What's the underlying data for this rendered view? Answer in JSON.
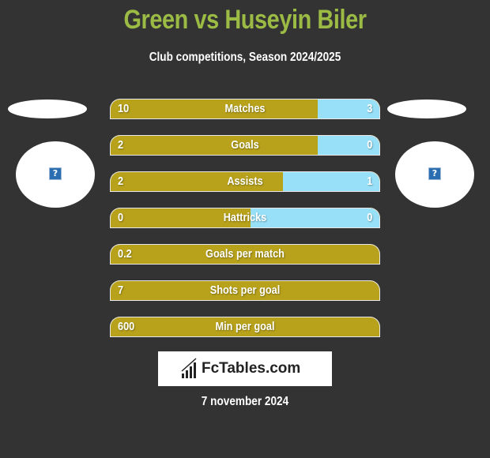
{
  "header": {
    "title": "Green vs Huseyin Biler",
    "subtitle": "Club competitions, Season 2024/2025"
  },
  "players": {
    "left": {
      "name": "Green",
      "avatar_icon": "question-image-icon"
    },
    "right": {
      "name": "Huseyin Biler",
      "avatar_icon": "question-image-icon"
    }
  },
  "colors": {
    "background": "#333333",
    "title": "#9bbb45",
    "left_bar": "#b8a21b",
    "right_bar": "#98e0f8"
  },
  "stats": [
    {
      "label": "Matches",
      "left": "10",
      "right": "3",
      "left_share": 0.77
    },
    {
      "label": "Goals",
      "left": "2",
      "right": "0",
      "left_share": 0.77
    },
    {
      "label": "Assists",
      "left": "2",
      "right": "1",
      "left_share": 0.64
    },
    {
      "label": "Hattricks",
      "left": "0",
      "right": "0",
      "left_share": 0.52
    },
    {
      "label": "Goals per match",
      "left": "0.2",
      "right": "",
      "left_share": 1.0
    },
    {
      "label": "Shots per goal",
      "left": "7",
      "right": "",
      "left_share": 1.0
    },
    {
      "label": "Min per goal",
      "left": "600",
      "right": "",
      "left_share": 1.0
    }
  ],
  "footer": {
    "logo_text": "FcTables.com",
    "date": "7 november 2024"
  }
}
